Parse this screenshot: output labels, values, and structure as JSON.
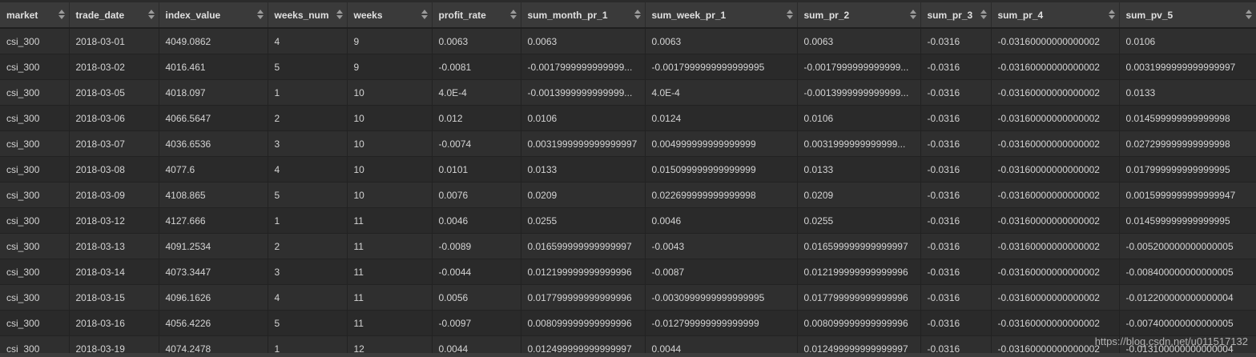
{
  "columns": [
    "market",
    "trade_date",
    "index_value",
    "weeks_num",
    "weeks",
    "profit_rate",
    "sum_month_pr_1",
    "sum_week_pr_1",
    "sum_pr_2",
    "sum_pr_3",
    "sum_pr_4",
    "sum_pv_5"
  ],
  "rows": [
    [
      "csi_300",
      "2018-03-01",
      "4049.0862",
      "4",
      "9",
      "0.0063",
      "0.0063",
      "0.0063",
      "0.0063",
      "-0.0316",
      "-0.03160000000000002",
      "0.0106"
    ],
    [
      "csi_300",
      "2018-03-02",
      "4016.461",
      "5",
      "9",
      "-0.0081",
      "-0.0017999999999999...",
      "-0.0017999999999999995",
      "-0.0017999999999999...",
      "-0.0316",
      "-0.03160000000000002",
      "0.0031999999999999997"
    ],
    [
      "csi_300",
      "2018-03-05",
      "4018.097",
      "1",
      "10",
      "4.0E-4",
      "-0.0013999999999999...",
      "4.0E-4",
      "-0.0013999999999999...",
      "-0.0316",
      "-0.03160000000000002",
      "0.0133"
    ],
    [
      "csi_300",
      "2018-03-06",
      "4066.5647",
      "2",
      "10",
      "0.012",
      "0.0106",
      "0.0124",
      "0.0106",
      "-0.0316",
      "-0.03160000000000002",
      "0.014599999999999998"
    ],
    [
      "csi_300",
      "2018-03-07",
      "4036.6536",
      "3",
      "10",
      "-0.0074",
      "0.0031999999999999997",
      "0.004999999999999999",
      "0.0031999999999999...",
      "-0.0316",
      "-0.03160000000000002",
      "0.027299999999999998"
    ],
    [
      "csi_300",
      "2018-03-08",
      "4077.6",
      "4",
      "10",
      "0.0101",
      "0.0133",
      "0.015099999999999999",
      "0.0133",
      "-0.0316",
      "-0.03160000000000002",
      "0.017999999999999995"
    ],
    [
      "csi_300",
      "2018-03-09",
      "4108.865",
      "5",
      "10",
      "0.0076",
      "0.0209",
      "0.022699999999999998",
      "0.0209",
      "-0.0316",
      "-0.03160000000000002",
      "0.0015999999999999947"
    ],
    [
      "csi_300",
      "2018-03-12",
      "4127.666",
      "1",
      "11",
      "0.0046",
      "0.0255",
      "0.0046",
      "0.0255",
      "-0.0316",
      "-0.03160000000000002",
      "0.014599999999999995"
    ],
    [
      "csi_300",
      "2018-03-13",
      "4091.2534",
      "2",
      "11",
      "-0.0089",
      "0.016599999999999997",
      "-0.0043",
      "0.016599999999999997",
      "-0.0316",
      "-0.03160000000000002",
      "-0.005200000000000005"
    ],
    [
      "csi_300",
      "2018-03-14",
      "4073.3447",
      "3",
      "11",
      "-0.0044",
      "0.012199999999999996",
      "-0.0087",
      "0.012199999999999996",
      "-0.0316",
      "-0.03160000000000002",
      "-0.008400000000000005"
    ],
    [
      "csi_300",
      "2018-03-15",
      "4096.1626",
      "4",
      "11",
      "0.0056",
      "0.017799999999999996",
      "-0.0030999999999999995",
      "0.017799999999999996",
      "-0.0316",
      "-0.03160000000000002",
      "-0.012200000000000004"
    ],
    [
      "csi_300",
      "2018-03-16",
      "4056.4226",
      "5",
      "11",
      "-0.0097",
      "0.008099999999999996",
      "-0.012799999999999999",
      "0.008099999999999996",
      "-0.0316",
      "-0.03160000000000002",
      "-0.007400000000000005"
    ],
    [
      "csi_300",
      "2018-03-19",
      "4074.2478",
      "1",
      "12",
      "0.0044",
      "0.012499999999999997",
      "0.0044",
      "0.012499999999999997",
      "-0.0316",
      "-0.03160000000000002",
      "-0.013100000000000004"
    ]
  ],
  "watermark": "https://blog.csdn.net/u011517132"
}
